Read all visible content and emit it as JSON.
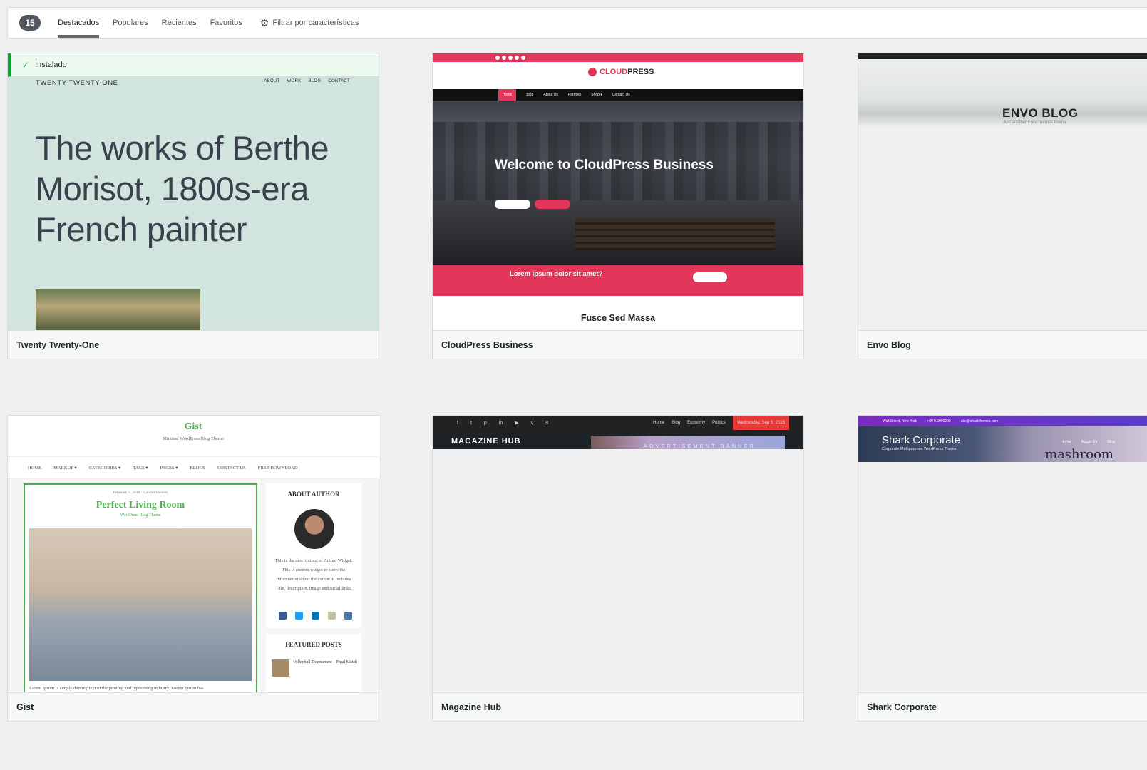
{
  "filter_bar": {
    "count": "15",
    "links": [
      {
        "label": "Destacados",
        "current": true
      },
      {
        "label": "Populares",
        "current": false
      },
      {
        "label": "Recientes",
        "current": false
      },
      {
        "label": "Favoritos",
        "current": false
      }
    ],
    "filter_label": "Filtrar por características"
  },
  "themes": {
    "twenty_twenty_one": {
      "name": "Twenty Twenty-One",
      "installed_label": "Instalado",
      "preview": {
        "site_title": "TWENTY TWENTY-ONE",
        "nav": [
          "ABOUT",
          "WORK",
          "BLOG",
          "CONTACT"
        ],
        "headline": "The works of Berthe Morisot, 1800s-era French painter"
      }
    },
    "cloudpress": {
      "name": "CloudPress Business",
      "preview": {
        "logo_main": "CLOUD",
        "logo_accent": "PRESS",
        "nav": [
          "Home",
          "Blog",
          "About Us",
          "Portfolio",
          "Shop ▾",
          "Contact Us"
        ],
        "hero_title": "Welcome to CloudPress Business",
        "band_title": "Lorem ipsum dolor sit amet?",
        "section_title": "Fusce Sed Massa"
      }
    },
    "envo_blog": {
      "name": "Envo Blog",
      "preview": {
        "title": "ENVO BLOG",
        "subtitle": "Just another EnvoThemes theme"
      }
    },
    "gist": {
      "name": "Gist",
      "preview": {
        "logo": "Gist",
        "tagline": "Minimal WordPress Blog Theme",
        "nav": [
          "HOME",
          "MARKUP ▾",
          "CATEGORIES ▾",
          "TAGS ▾",
          "PAGES ▾",
          "BLOGS",
          "CONTACT US",
          "FREE DOWNLOAD"
        ],
        "post_meta": "February 5, 2018 · Candid Themes",
        "post_title": "Perfect Living Room",
        "post_subtitle": "WordPress Blog Theme",
        "excerpt": "Lorem Ipsum is simply dummy text of the printing and typesetting industry. Lorem Ipsum has",
        "about_heading": "ABOUT AUTHOR",
        "about_text": "This is the descriptions of Author Widget. This is custom widget to show the information about the author. It includes Title, description, image and social links.",
        "featured_heading": "FEATURED POSTS",
        "featured_post": "Volleyball Tournament – Final Match",
        "social_colors": [
          "#3b5998",
          "#1da1f2",
          "#0077b5",
          "#c9c0a0",
          "#4a76a8"
        ]
      }
    },
    "magazine_hub": {
      "name": "Magazine Hub",
      "preview": {
        "nav": [
          "Home",
          "Blog",
          "Economy",
          "Politics"
        ],
        "date": "Wednesday, Sep 5, 2018",
        "logo": "MAGAZINE HUB",
        "ad_text": "ADVERTISEMENT BANNER"
      }
    },
    "shark_corporate": {
      "name": "Shark Corporate",
      "preview": {
        "address": "Wall Street, New York",
        "phone": "+00 0.0000000",
        "email": "abc@sharkthemes.com",
        "title": "Shark Corporate",
        "subtitle": "Corporate Multipurpose WordPress Theme",
        "nav": [
          "Home",
          "About Us",
          "Blog"
        ],
        "brand": "mashroom"
      }
    }
  },
  "colors": {
    "accent_installed": "#00a32a",
    "cloudpress_red": "#e2375a",
    "gist_green": "#4caf50"
  }
}
